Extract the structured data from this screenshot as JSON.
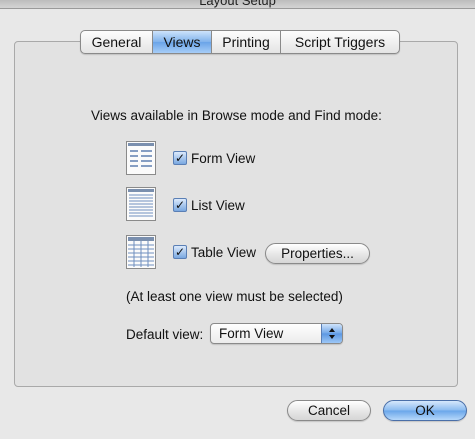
{
  "window": {
    "title": "Layout Setup"
  },
  "tabs": [
    {
      "label": "General",
      "selected": false
    },
    {
      "label": "Views",
      "selected": true
    },
    {
      "label": "Printing",
      "selected": false
    },
    {
      "label": "Script Triggers",
      "selected": false
    }
  ],
  "views": {
    "heading": "Views available in Browse mode and Find mode:",
    "items": [
      {
        "label": "Form View",
        "checked": true,
        "icon": "form-view-icon"
      },
      {
        "label": "List View",
        "checked": true,
        "icon": "list-view-icon"
      },
      {
        "label": "Table View",
        "checked": true,
        "icon": "table-view-icon"
      }
    ],
    "properties_button": "Properties...",
    "note": "(At least one view must be selected)",
    "default_view_label": "Default view:",
    "default_view_value": "Form View"
  },
  "buttons": {
    "cancel": "Cancel",
    "ok": "OK"
  },
  "colors": {
    "accent": "#6aa4e8",
    "panel": "#e2e2e2",
    "window": "#e8e8e8"
  }
}
